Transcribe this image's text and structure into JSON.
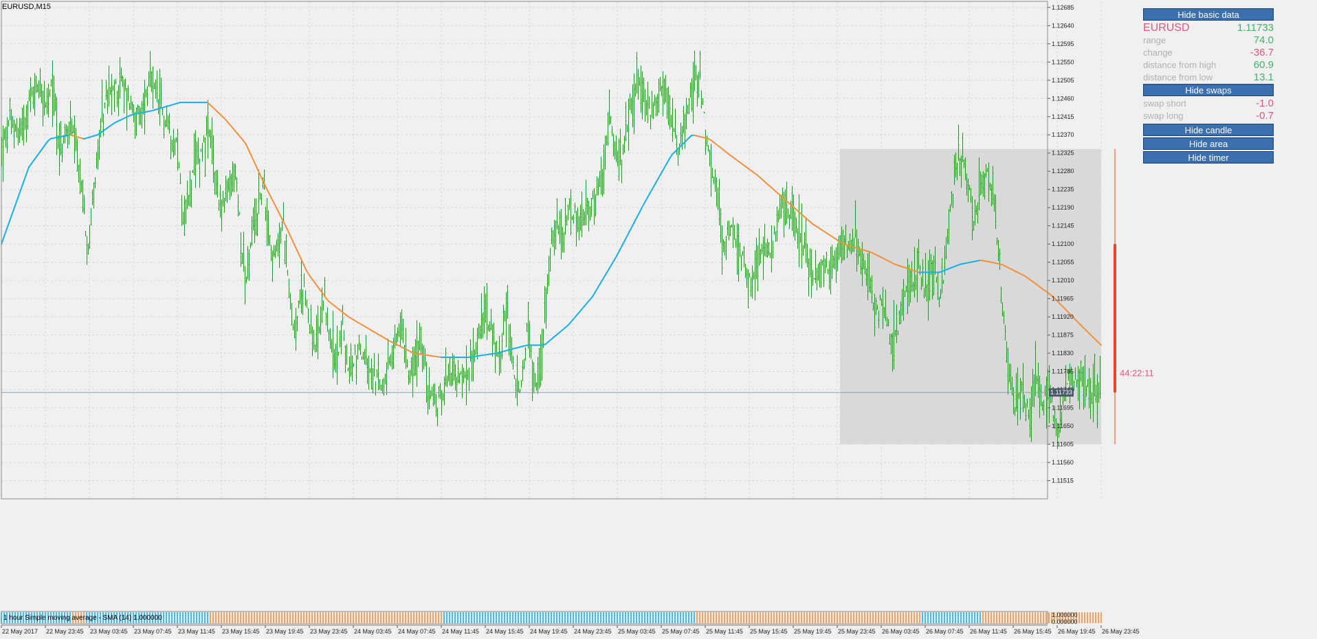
{
  "window": {
    "title": "EURUSD,M15"
  },
  "panel": {
    "buttons": {
      "hide_basic": "Hide basic data",
      "hide_swaps": "Hide swaps",
      "hide_candle": "Hide candle",
      "hide_area": "Hide area",
      "hide_timer": "Hide timer"
    },
    "symbol": "EURUSD",
    "price": "1.11733",
    "rows": [
      {
        "label": "range",
        "value": "74.0",
        "tone": "pos"
      },
      {
        "label": "change",
        "value": "-36.7",
        "tone": "neg"
      },
      {
        "label": "distance from high",
        "value": "60.9",
        "tone": "pos"
      },
      {
        "label": "distance from low",
        "value": "13.1",
        "tone": "pos"
      }
    ],
    "swaps": [
      {
        "label": "swap short",
        "value": "-1.0",
        "tone": "neg"
      },
      {
        "label": "swap long",
        "value": "-0.7",
        "tone": "neg"
      }
    ]
  },
  "timer": "44:22:11",
  "indicator_label": "1 hour Simple moving average - SMA (14) 1.000000",
  "colors": {
    "background": "#f0f0f0",
    "grid": "#d8d8d8",
    "bars": "#2e8b2e",
    "ma_up": "#1aaee8",
    "ma_down": "#f0913e",
    "area": "#d9d9d9",
    "candle": "#e04a1e",
    "timer": "#e0557e",
    "current_price_line": "#8aa0b0"
  },
  "chart_data": {
    "type": "ohlc",
    "symbol": "EURUSD",
    "timeframe": "M15",
    "y_ticks": [
      "1.12685",
      "1.12640",
      "1.12595",
      "1.12550",
      "1.12505",
      "1.12460",
      "1.12415",
      "1.12370",
      "1.12325",
      "1.12280",
      "1.12235",
      "1.12190",
      "1.12145",
      "1.12100",
      "1.12055",
      "1.12010",
      "1.11965",
      "1.11920",
      "1.11875",
      "1.11830",
      "1.11785",
      "1.11740",
      "1.11695",
      "1.11650",
      "1.11605",
      "1.11560",
      "1.11515"
    ],
    "ylim": [
      1.1147,
      1.127
    ],
    "x_ticks": [
      "22 May 2017",
      "22 May 23:45",
      "23 May 03:45",
      "23 May 07:45",
      "23 May 11:45",
      "23 May 15:45",
      "23 May 19:45",
      "23 May 23:45",
      "24 May 03:45",
      "24 May 07:45",
      "24 May 11:45",
      "24 May 15:45",
      "24 May 19:45",
      "24 May 23:45",
      "25 May 03:45",
      "25 May 07:45",
      "25 May 11:45",
      "25 May 15:45",
      "25 May 19:45",
      "25 May 23:45",
      "26 May 03:45",
      "26 May 07:45",
      "26 May 11:45",
      "26 May 15:45",
      "26 May 19:45",
      "26 May 23:45"
    ],
    "current_price": 1.11733,
    "current_price_label": "1.11733",
    "price_anchors": [
      [
        0,
        1.1233
      ],
      [
        12,
        1.124
      ],
      [
        25,
        1.1238
      ],
      [
        40,
        1.1245
      ],
      [
        55,
        1.125
      ],
      [
        65,
        1.1243
      ],
      [
        75,
        1.125
      ],
      [
        85,
        1.1232
      ],
      [
        100,
        1.124
      ],
      [
        115,
        1.1225
      ],
      [
        125,
        1.121
      ],
      [
        135,
        1.1225
      ],
      [
        150,
        1.1245
      ],
      [
        175,
        1.125
      ],
      [
        200,
        1.124
      ],
      [
        215,
        1.125
      ],
      [
        235,
        1.1242
      ],
      [
        255,
        1.1235
      ],
      [
        265,
        1.1215
      ],
      [
        280,
        1.1228
      ],
      [
        300,
        1.1238
      ],
      [
        320,
        1.1218
      ],
      [
        340,
        1.1228
      ],
      [
        355,
        1.12
      ],
      [
        365,
        1.1212
      ],
      [
        380,
        1.1225
      ],
      [
        395,
        1.1205
      ],
      [
        410,
        1.1215
      ],
      [
        425,
        1.1188
      ],
      [
        440,
        1.12
      ],
      [
        455,
        1.1183
      ],
      [
        470,
        1.1195
      ],
      [
        485,
        1.118
      ],
      [
        495,
        1.119
      ],
      [
        505,
        1.1178
      ],
      [
        520,
        1.1185
      ],
      [
        535,
        1.1178
      ],
      [
        550,
        1.1175
      ],
      [
        565,
        1.118
      ],
      [
        580,
        1.119
      ],
      [
        595,
        1.1178
      ],
      [
        610,
        1.1185
      ],
      [
        620,
        1.1175
      ],
      [
        635,
        1.117
      ],
      [
        650,
        1.118
      ],
      [
        665,
        1.1176
      ],
      [
        680,
        1.1178
      ],
      [
        695,
        1.119
      ],
      [
        705,
        1.1194
      ],
      [
        715,
        1.1185
      ],
      [
        725,
        1.1182
      ],
      [
        735,
        1.1195
      ],
      [
        745,
        1.1178
      ],
      [
        755,
        1.1172
      ],
      [
        765,
        1.119
      ],
      [
        775,
        1.1175
      ],
      [
        785,
        1.118
      ],
      [
        795,
        1.1205
      ],
      [
        805,
        1.1215
      ],
      [
        815,
        1.121
      ],
      [
        825,
        1.1218
      ],
      [
        840,
        1.1215
      ],
      [
        860,
        1.122
      ],
      [
        875,
        1.1228
      ],
      [
        885,
        1.124
      ],
      [
        900,
        1.1228
      ],
      [
        915,
        1.1245
      ],
      [
        925,
        1.125
      ],
      [
        945,
        1.1242
      ],
      [
        960,
        1.125
      ],
      [
        970,
        1.1245
      ],
      [
        985,
        1.1232
      ],
      [
        1000,
        1.1245
      ],
      [
        1015,
        1.1255
      ],
      [
        1025,
        1.1235
      ],
      [
        1040,
        1.1222
      ],
      [
        1050,
        1.121
      ],
      [
        1060,
        1.1215
      ],
      [
        1080,
        1.1205
      ],
      [
        1090,
        1.12
      ],
      [
        1105,
        1.121
      ],
      [
        1115,
        1.1208
      ],
      [
        1125,
        1.1212
      ],
      [
        1140,
        1.122
      ],
      [
        1155,
        1.1215
      ],
      [
        1165,
        1.1212
      ],
      [
        1180,
        1.12
      ],
      [
        1195,
        1.1205
      ],
      [
        1205,
        1.1202
      ],
      [
        1215,
        1.121
      ],
      [
        1225,
        1.121
      ],
      [
        1240,
        1.1212
      ],
      [
        1250,
        1.1205
      ],
      [
        1260,
        1.1203
      ],
      [
        1270,
        1.1195
      ],
      [
        1285,
        1.1195
      ],
      [
        1295,
        1.1185
      ],
      [
        1305,
        1.119
      ],
      [
        1315,
        1.1198
      ],
      [
        1325,
        1.12
      ],
      [
        1335,
        1.1205
      ],
      [
        1345,
        1.1198
      ],
      [
        1355,
        1.1205
      ],
      [
        1365,
        1.1195
      ],
      [
        1375,
        1.121
      ],
      [
        1385,
        1.1225
      ],
      [
        1395,
        1.1232
      ],
      [
        1405,
        1.1225
      ],
      [
        1415,
        1.1215
      ],
      [
        1425,
        1.1225
      ],
      [
        1435,
        1.1228
      ],
      [
        1445,
        1.122
      ],
      [
        1455,
        1.1195
      ],
      [
        1465,
        1.118
      ],
      [
        1475,
        1.117
      ],
      [
        1485,
        1.1175
      ],
      [
        1495,
        1.1165
      ],
      [
        1505,
        1.118
      ],
      [
        1515,
        1.117
      ],
      [
        1525,
        1.1175
      ],
      [
        1535,
        1.1162
      ],
      [
        1545,
        1.117
      ],
      [
        1555,
        1.1178
      ],
      [
        1565,
        1.1176
      ],
      [
        1575,
        1.1178
      ],
      [
        1585,
        1.1172
      ],
      [
        1595,
        1.1174
      ],
      [
        1600,
        1.11733
      ]
    ],
    "moving_average": {
      "name": "1 hour Simple moving average - SMA (14)",
      "anchors": [
        [
          0,
          1.121
        ],
        [
          40,
          1.1229
        ],
        [
          70,
          1.1236
        ],
        [
          100,
          1.1237
        ],
        [
          120,
          1.1236
        ],
        [
          140,
          1.1237
        ],
        [
          165,
          1.124
        ],
        [
          190,
          1.1242
        ],
        [
          220,
          1.1243
        ],
        [
          260,
          1.1245
        ],
        [
          300,
          1.1245
        ],
        [
          325,
          1.1241
        ],
        [
          355,
          1.1235
        ],
        [
          385,
          1.1224
        ],
        [
          415,
          1.1214
        ],
        [
          445,
          1.1203
        ],
        [
          475,
          1.1196
        ],
        [
          505,
          1.1192
        ],
        [
          535,
          1.1189
        ],
        [
          565,
          1.1186
        ],
        [
          600,
          1.1183
        ],
        [
          640,
          1.1182
        ],
        [
          680,
          1.1182
        ],
        [
          720,
          1.1183
        ],
        [
          765,
          1.1185
        ],
        [
          790,
          1.1185
        ],
        [
          825,
          1.119
        ],
        [
          860,
          1.1197
        ],
        [
          895,
          1.1207
        ],
        [
          935,
          1.122
        ],
        [
          975,
          1.1232
        ],
        [
          1005,
          1.1237
        ],
        [
          1030,
          1.1236
        ],
        [
          1060,
          1.1232
        ],
        [
          1100,
          1.1227
        ],
        [
          1140,
          1.1221
        ],
        [
          1180,
          1.1215
        ],
        [
          1225,
          1.121
        ],
        [
          1265,
          1.1208
        ],
        [
          1300,
          1.1205
        ],
        [
          1335,
          1.1203
        ],
        [
          1365,
          1.1203
        ],
        [
          1395,
          1.1205
        ],
        [
          1425,
          1.1206
        ],
        [
          1455,
          1.1205
        ],
        [
          1490,
          1.1202
        ],
        [
          1530,
          1.1197
        ],
        [
          1570,
          1.119
        ],
        [
          1600,
          1.1185
        ]
      ]
    },
    "highlight_area": {
      "from": 1.11605,
      "to": 1.12335
    },
    "current_candle": {
      "open": 1.121,
      "close": 1.11733,
      "high": 1.12335,
      "low": 1.11605
    },
    "grid": true
  }
}
